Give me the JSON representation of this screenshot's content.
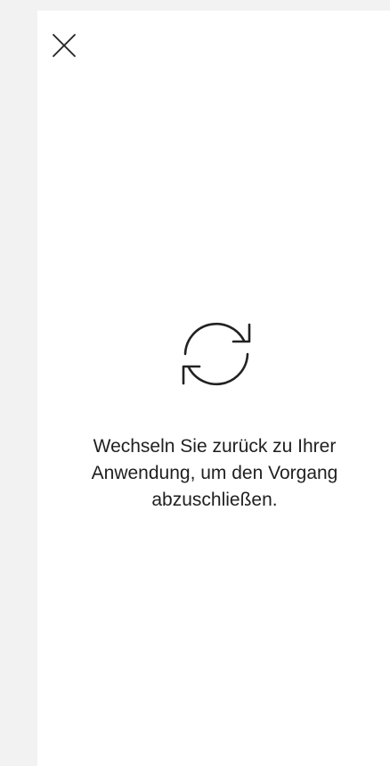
{
  "dialog": {
    "close_icon": "close-icon",
    "status_icon": "sync-arrows-icon",
    "message": "Wechseln Sie zurück zu Ihrer\nAnwendung, um den Vorgang\nabzuschließen."
  },
  "colors": {
    "background": "#f2f2f2",
    "panel": "#ffffff",
    "text": "#1f1f1f",
    "icon": "#222222"
  }
}
